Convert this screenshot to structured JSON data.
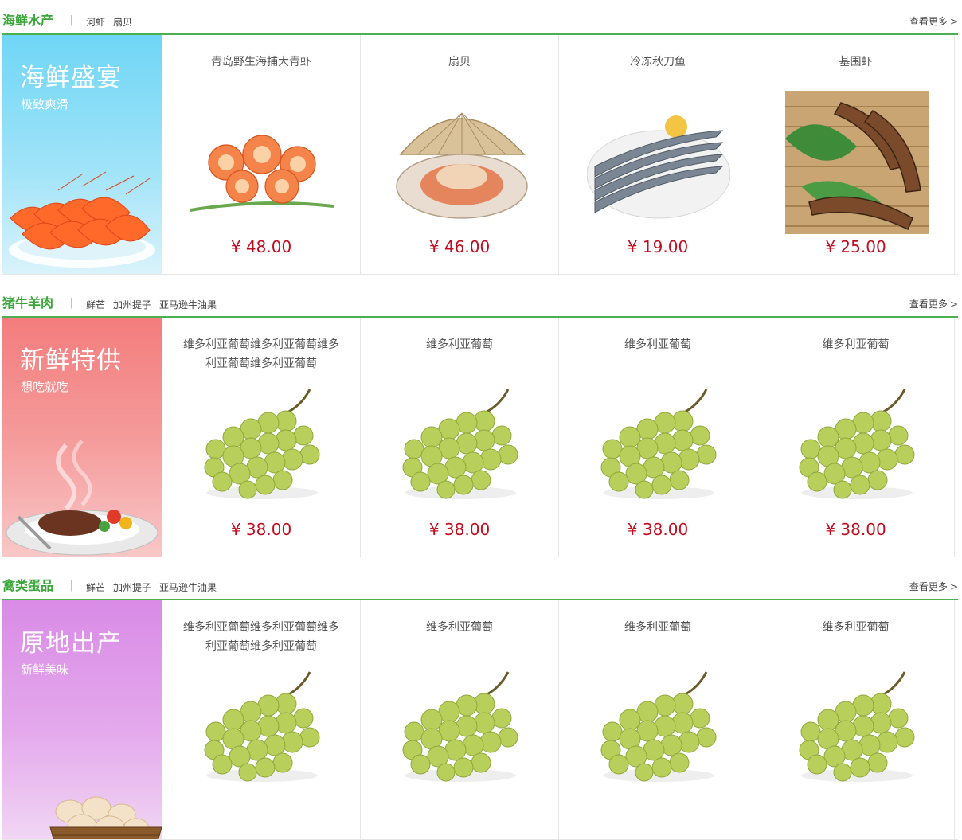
{
  "sections": [
    {
      "title": "海鲜水产",
      "separator": "|",
      "tags": [
        "河虾",
        "扇贝"
      ],
      "more": "查看更多",
      "more_icon": "chevron-right-icon",
      "banner": {
        "title": "海鲜盛宴",
        "subtitle": "极致爽滑",
        "color": "#6fd6f6"
      },
      "products": [
        {
          "name": "青岛野生海捕大青虾",
          "price": "¥ 48.00",
          "image": "shrimp"
        },
        {
          "name": "扇贝",
          "price": "¥ 46.00",
          "image": "scallop"
        },
        {
          "name": "冷冻秋刀鱼",
          "price": "¥ 19.00",
          "image": "saury"
        },
        {
          "name": "基围虾",
          "price": "¥ 25.00",
          "image": "prawn"
        }
      ]
    },
    {
      "title": "猪牛羊肉",
      "separator": "|",
      "tags": [
        "鲜芒",
        "加州提子",
        "亚马逊牛油果"
      ],
      "more": "查看更多",
      "more_icon": "chevron-right-icon",
      "banner": {
        "title": "新鲜特供",
        "subtitle": "想吃就吃",
        "color": "#f47d7d"
      },
      "products": [
        {
          "name": "维多利亚葡萄维多利亚葡萄维多利亚葡萄维多利亚葡萄",
          "price": "¥ 38.00",
          "image": "grapes"
        },
        {
          "name": "维多利亚葡萄",
          "price": "¥ 38.00",
          "image": "grapes"
        },
        {
          "name": "维多利亚葡萄",
          "price": "¥ 38.00",
          "image": "grapes"
        },
        {
          "name": "维多利亚葡萄",
          "price": "¥ 38.00",
          "image": "grapes"
        }
      ]
    },
    {
      "title": "禽类蛋品",
      "separator": "|",
      "tags": [
        "鲜芒",
        "加州提子",
        "亚马逊牛油果"
      ],
      "more": "查看更多",
      "more_icon": "chevron-right-icon",
      "banner": {
        "title": "原地出产",
        "subtitle": "新鲜美味",
        "color": "#d98be6"
      },
      "products": [
        {
          "name": "维多利亚葡萄维多利亚葡萄维多利亚葡萄维多利亚葡萄",
          "price": "",
          "image": "grapes"
        },
        {
          "name": "维多利亚葡萄",
          "price": "",
          "image": "grapes"
        },
        {
          "name": "维多利亚葡萄",
          "price": "",
          "image": "grapes"
        },
        {
          "name": "维多利亚葡萄",
          "price": "",
          "image": "grapes"
        }
      ]
    }
  ],
  "colors": {
    "accent": "#4caf50",
    "price": "#c20d20"
  }
}
